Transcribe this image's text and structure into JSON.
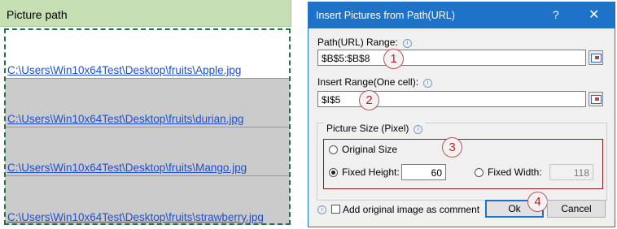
{
  "sheet": {
    "header": "Picture path",
    "rows": [
      "C:\\Users\\Win10x64Test\\Desktop\\fruits\\Apple.jpg",
      "C:\\Users\\Win10x64Test\\Desktop\\fruits\\durian.jpg",
      "C:\\Users\\Win10x64Test\\Desktop\\fruits\\Mango.jpg",
      "C:\\Users\\Win10x64Test\\Desktop\\fruits\\strawberry.jpg"
    ]
  },
  "dialog": {
    "title": "Insert Pictures from Path(URL)",
    "help": "?",
    "close": "✕",
    "path_label": "Path(URL) Range:",
    "path_value": "$B$5:$B$8",
    "insert_label": "Insert Range(One cell):",
    "insert_value": "$I$5",
    "size_group": "Picture Size (Pixel)",
    "original_size": "Original Size",
    "fixed_height_label": "Fixed Height:",
    "fixed_height_value": "60",
    "fixed_width_label": "Fixed Width:",
    "fixed_width_value": "118",
    "comment_label": "Add original image as comment",
    "ok": "Ok",
    "cancel": "Cancel",
    "info_glyph": "i",
    "badges": [
      "1",
      "2",
      "3",
      "4"
    ]
  },
  "colors": {
    "accent": "#1e72c8",
    "header_fill": "#c6e0b4",
    "link": "#1f4fd1",
    "badge": "#c02020"
  }
}
